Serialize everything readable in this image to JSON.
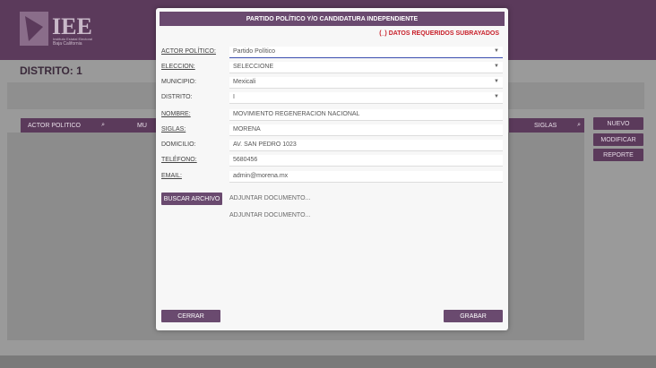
{
  "brand": {
    "name": "IEE",
    "subtitle_line1": "Instituto Estatal Electoral",
    "subtitle_line2": "Baja California"
  },
  "page": {
    "distrito": "DISTRITO: 1"
  },
  "grid": {
    "columns": [
      "ACTOR POLITICO",
      "MU",
      "SIGLAS"
    ]
  },
  "actions": {
    "nuevo": "NUEVO",
    "modificar": "MODIFICAR",
    "reporte": "REPORTE"
  },
  "modal": {
    "title": "PARTIDO POLÍTICO Y/O CANDIDATURA INDEPENDIENTE",
    "required_note": "(_) DATOS REQUERIDOS SUBRAYADOS",
    "fields": {
      "actor_politico": {
        "label": "ACTOR POLÍTICO:",
        "value": "Partido Político"
      },
      "eleccion": {
        "label": "ELECCION:",
        "value": "SELECCIONE"
      },
      "municipio": {
        "label": "MUNICIPIO:",
        "value": "Mexicali"
      },
      "distrito": {
        "label": "DISTRITO:",
        "value": "I"
      },
      "nombre": {
        "label": "NOMBRE:",
        "value": "MOVIMIENTO REGENERACION NACIONAL"
      },
      "siglas": {
        "label": "SIGLAS:",
        "value": "MORENA"
      },
      "domicilio": {
        "label": "DOMICILIO:",
        "value": "AV. SAN PEDRO 1023"
      },
      "telefono": {
        "label": "TELÉFONO:",
        "value": "5680456"
      },
      "email": {
        "label": "EMAIL:",
        "value": "admin@morena.mx"
      }
    },
    "buscar": "BUSCAR ARCHIVO",
    "adjuntar1": "ADJUNTAR DOCUMENTO...",
    "adjuntar2": "ADJUNTAR DOCUMENTO...",
    "cerrar": "CERRAR",
    "grabar": "GRABAR"
  },
  "colors": {
    "brand_purple": "#5b3a5b",
    "modal_purple": "#6a4a6f",
    "required_red": "#c8202a"
  }
}
